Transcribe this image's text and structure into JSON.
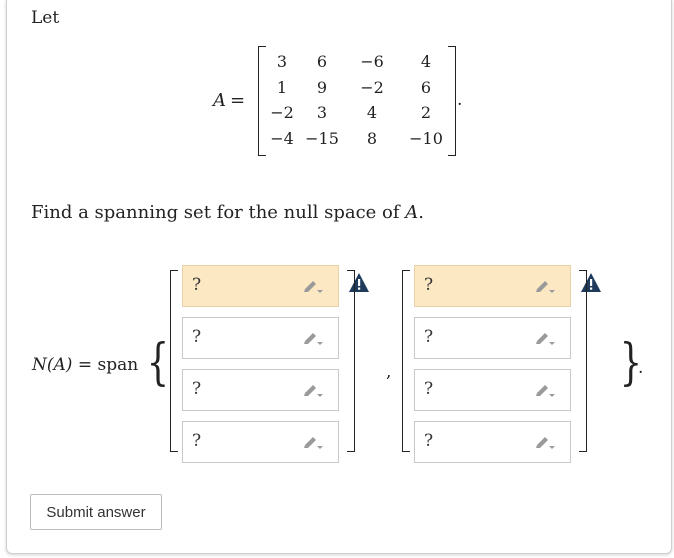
{
  "question": {
    "intro": "Let",
    "matrix_name": "A",
    "equals": "=",
    "matrix": [
      [
        "3",
        "6",
        "−6",
        "4"
      ],
      [
        "1",
        "9",
        "−2",
        "6"
      ],
      [
        "−2",
        "3",
        "4",
        "2"
      ],
      [
        "−4",
        "−15",
        "8",
        "−10"
      ]
    ],
    "period": ".",
    "task_prefix": "Find a spanning set for the null space of ",
    "task_var": "A",
    "task_suffix": "."
  },
  "answer": {
    "label_fn": "N",
    "label_arg": "(A)",
    "label_rest": " = span",
    "brace_open": "{",
    "brace_close": "}",
    "close_period": ".",
    "separator": ",",
    "vectors": [
      {
        "entries": [
          "?",
          "?",
          "?",
          "?"
        ]
      },
      {
        "entries": [
          "?",
          "?",
          "?",
          "?"
        ]
      }
    ]
  },
  "submit_label": "Submit answer",
  "colors": {
    "warning_fill": "#fde8c4",
    "alert_icon": "#1f3b5c",
    "pencil": "#9a9a9a"
  }
}
